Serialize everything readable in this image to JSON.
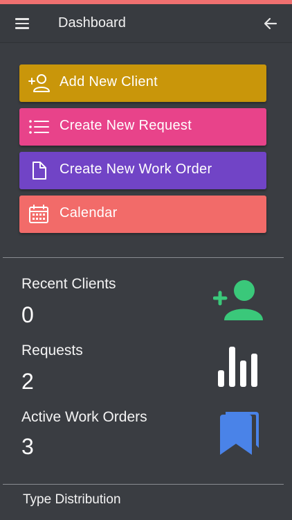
{
  "header": {
    "title": "Dashboard"
  },
  "actions": [
    {
      "label": "Add New Client",
      "icon": "add-user-icon",
      "color": "#c9960a"
    },
    {
      "label": "Create New Request",
      "icon": "list-icon",
      "color": "#e8438a"
    },
    {
      "label": "Create New Work Order",
      "icon": "document-icon",
      "color": "#7144c6"
    },
    {
      "label": "Calendar",
      "icon": "calendar-icon",
      "color": "#f26b69"
    }
  ],
  "stats": [
    {
      "title": "Recent Clients",
      "value": "0",
      "icon": "add-person-icon",
      "color": "#3ac87a"
    },
    {
      "title": "Requests",
      "value": "2",
      "icon": "bar-chart-icon",
      "color": "#ffffff"
    },
    {
      "title": "Active Work Orders",
      "value": "3",
      "icon": "bookmarks-icon",
      "color": "#4a83e8"
    }
  ],
  "sections": {
    "type_distribution": "Type Distribution"
  },
  "colors": {
    "background": "#3a3d42",
    "accent": "#f07070"
  }
}
